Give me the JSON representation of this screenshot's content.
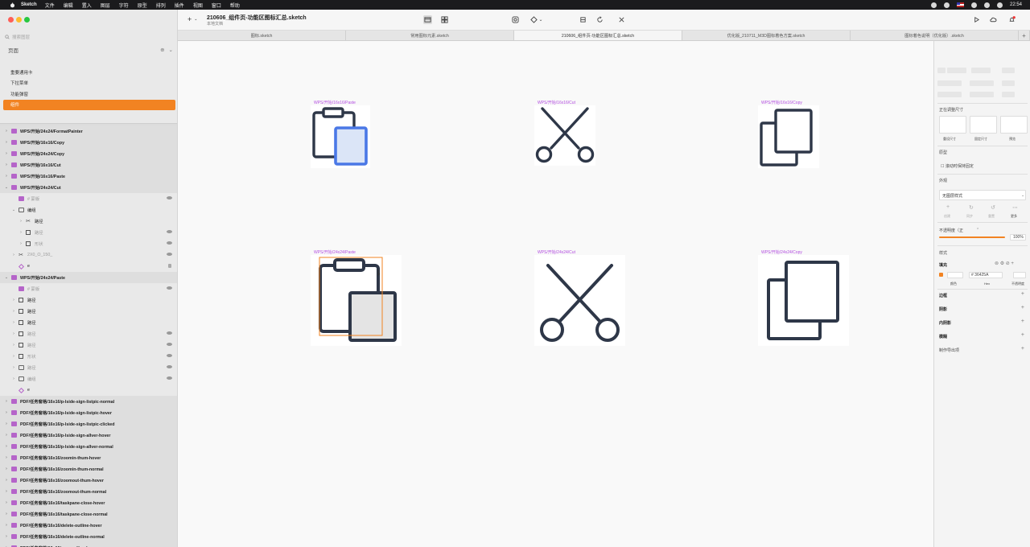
{
  "menubar": {
    "app_name": "Sketch",
    "items": [
      "文件",
      "编辑",
      "置入",
      "图层",
      "字符",
      "原型",
      "排列",
      "插件",
      "视图",
      "窗口",
      "帮助"
    ],
    "time": "22:54"
  },
  "sidebar": {
    "search_placeholder": "搜索图层",
    "pages_title": "页面",
    "pages": [
      "重要通用卡",
      "下拉菜单",
      "功能弹窗",
      "组件"
    ],
    "active_page": 3,
    "layers": [
      {
        "label": "WPS/开始/24x24/FormatPainter",
        "type": "board"
      },
      {
        "label": "WPS/开始/16x16/Copy",
        "type": "board"
      },
      {
        "label": "WPS/开始/24x24/Copy",
        "type": "board"
      },
      {
        "label": "WPS/开始/16x16/Cut",
        "type": "board"
      },
      {
        "label": "WPS/开始/16x16/Paste",
        "type": "board"
      },
      {
        "label": "WPS/开始/24x24/Cut",
        "type": "board-open"
      },
      {
        "label": "# 蒙版",
        "type": "sym",
        "indent": 1,
        "faded": true,
        "eye": true
      },
      {
        "label": "编组",
        "type": "grp-open",
        "indent": 1
      },
      {
        "label": "路径",
        "type": "cut",
        "indent": 2
      },
      {
        "label": "路径",
        "type": "shape",
        "indent": 2,
        "faded": true,
        "eye": true
      },
      {
        "label": "形状",
        "type": "shape",
        "indent": 2,
        "faded": true,
        "eye": true
      },
      {
        "label": "2X0_O_150_",
        "type": "cut",
        "indent": 1,
        "faded": true,
        "eye": true
      },
      {
        "label": "e",
        "type": "dia",
        "indent": 1,
        "lock": true
      },
      {
        "label": "WPS/开始/24x24/Paste",
        "type": "board-open"
      },
      {
        "label": "# 蒙版",
        "type": "sym",
        "indent": 1,
        "faded": true,
        "eye": true
      },
      {
        "label": "路径",
        "type": "shape",
        "indent": 1
      },
      {
        "label": "路径",
        "type": "shape",
        "indent": 1
      },
      {
        "label": "路径",
        "type": "shape",
        "indent": 1
      },
      {
        "label": "路径",
        "type": "shape",
        "indent": 1,
        "faded": true,
        "eye": true
      },
      {
        "label": "路径",
        "type": "shape",
        "indent": 1,
        "faded": true,
        "eye": true
      },
      {
        "label": "形状",
        "type": "shape",
        "indent": 1,
        "faded": true,
        "eye": true
      },
      {
        "label": "路径",
        "type": "grp",
        "indent": 1,
        "faded": true,
        "eye": true
      },
      {
        "label": "编组",
        "type": "grp",
        "indent": 1,
        "faded": true,
        "eye": true
      },
      {
        "label": "e",
        "type": "dia",
        "indent": 1
      },
      {
        "label": "PDF/任务窗格/16x16/p-lside-sign-listpic-normal",
        "type": "board"
      },
      {
        "label": "PDF/任务窗格/16x16/p-lside-sign-listpic-hover",
        "type": "board"
      },
      {
        "label": "PDF/任务窗格/16x16/p-lside-sign-listpic-clicked",
        "type": "board"
      },
      {
        "label": "PDF/任务窗格/16x16/p-lside-sign-allver-hover",
        "type": "board"
      },
      {
        "label": "PDF/任务窗格/16x16/p-lside-sign-allver-normal",
        "type": "board"
      },
      {
        "label": "PDF/任务窗格/16x16/zoomin-thum-hover",
        "type": "board"
      },
      {
        "label": "PDF/任务窗格/16x16/zoomin-thum-normal",
        "type": "board"
      },
      {
        "label": "PDF/任务窗格/16x16/zoomout-thum-hover",
        "type": "board"
      },
      {
        "label": "PDF/任务窗格/16x16/zoomout-thum-normal",
        "type": "board"
      },
      {
        "label": "PDF/任务窗格/16x16/taskpane-close-hover",
        "type": "board"
      },
      {
        "label": "PDF/任务窗格/16x16/taskpane-close-normal",
        "type": "board"
      },
      {
        "label": "PDF/任务窗格/16x16/delete-outline-hover",
        "type": "board"
      },
      {
        "label": "PDF/任务窗格/16x16/delete-outline-normal",
        "type": "board"
      },
      {
        "label": "PDF/任务窗格/16x16/new-outline-hover",
        "type": "board"
      }
    ]
  },
  "toolbar": {
    "insert_label": "+",
    "doc_title": "210606_组件页-功能区图标汇总.sketch",
    "doc_subtitle": "本地文档"
  },
  "tabs": [
    "图标.sketch",
    "常用图标元素.sketch",
    "210606_组件页-功能区图标汇总.sketch",
    "优化版_210711_M3D图标着色方案.sketch",
    "图标着色说明（优化版）.sketch"
  ],
  "active_tab": 2,
  "canvas": {
    "artboards": [
      {
        "label": "WPS/开始/16x16/Paste",
        "icon": "paste-small"
      },
      {
        "label": "WPS/开始/16x16/Cut",
        "icon": "cut-small"
      },
      {
        "label": "WPS/开始/16x16/Copy",
        "icon": "copy-small"
      },
      {
        "label": "WPS/开始/24x24/Paste",
        "icon": "paste-large"
      },
      {
        "label": "WPS/开始/24x24/Cut",
        "icon": "cut-large"
      },
      {
        "label": "WPS/开始/24x24/Copy",
        "icon": "copy-large"
      }
    ],
    "colors": {
      "stroke": "#2e3748",
      "accent": "#4a78e6",
      "accent_fill": "#dbe5f7",
      "selection": "#f28322",
      "label": "#b34de1"
    }
  },
  "inspector": {
    "resize_title": "正在调整尺寸",
    "resize_options": [
      "重设尺寸",
      "固定尺寸",
      "预览"
    ],
    "prototype_title": "原型",
    "prototype_option": "滚动时保持固定",
    "appearance_title": "外观",
    "layer_style": "无图层样式",
    "style_actions": [
      "创建",
      "同步",
      "重置",
      "更多"
    ],
    "opacity_label": "不透明度（正",
    "opacity_value": "100%",
    "style_title": "样式",
    "fill_title": "填充",
    "fill_hex": "# 36425A",
    "fill_sublabels": [
      "颜色",
      "Hex",
      "不透明度"
    ],
    "sections": [
      "边框",
      "阴影",
      "内阴影",
      "模糊",
      "制作导出项"
    ]
  }
}
